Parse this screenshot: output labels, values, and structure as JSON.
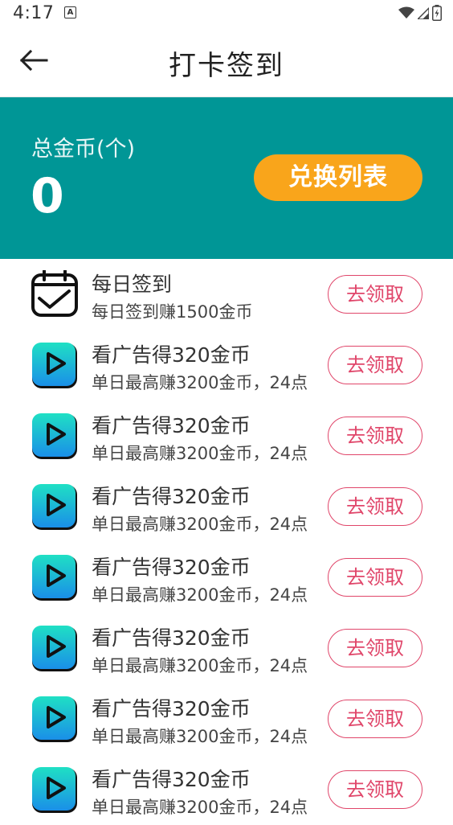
{
  "status_bar": {
    "time": "4:17",
    "notification_glyph": "A",
    "icons": [
      "wifi-icon",
      "signal-icon",
      "battery-icon"
    ]
  },
  "header": {
    "title": "打卡签到",
    "back_icon": "arrow-left-icon"
  },
  "banner": {
    "coin_label": "总金币(个)",
    "coin_value": "0",
    "exchange_label": "兑换列表",
    "background_color": "#009696",
    "button_color": "#f9a51b"
  },
  "tasks": [
    {
      "icon": "calendar-check-icon",
      "title": "每日签到",
      "desc": "每日签到赚1500金币",
      "action": "去领取"
    },
    {
      "icon": "play-video-icon",
      "title": "看广告得320金币",
      "desc": "单日最高赚3200金币，24点",
      "action": "去领取"
    },
    {
      "icon": "play-video-icon",
      "title": "看广告得320金币",
      "desc": "单日最高赚3200金币，24点",
      "action": "去领取"
    },
    {
      "icon": "play-video-icon",
      "title": "看广告得320金币",
      "desc": "单日最高赚3200金币，24点",
      "action": "去领取"
    },
    {
      "icon": "play-video-icon",
      "title": "看广告得320金币",
      "desc": "单日最高赚3200金币，24点",
      "action": "去领取"
    },
    {
      "icon": "play-video-icon",
      "title": "看广告得320金币",
      "desc": "单日最高赚3200金币，24点",
      "action": "去领取"
    },
    {
      "icon": "play-video-icon",
      "title": "看广告得320金币",
      "desc": "单日最高赚3200金币，24点",
      "action": "去领取"
    },
    {
      "icon": "play-video-icon",
      "title": "看广告得320金币",
      "desc": "单日最高赚3200金币，24点",
      "action": "去领取"
    }
  ],
  "accent_color": "#e0466a"
}
